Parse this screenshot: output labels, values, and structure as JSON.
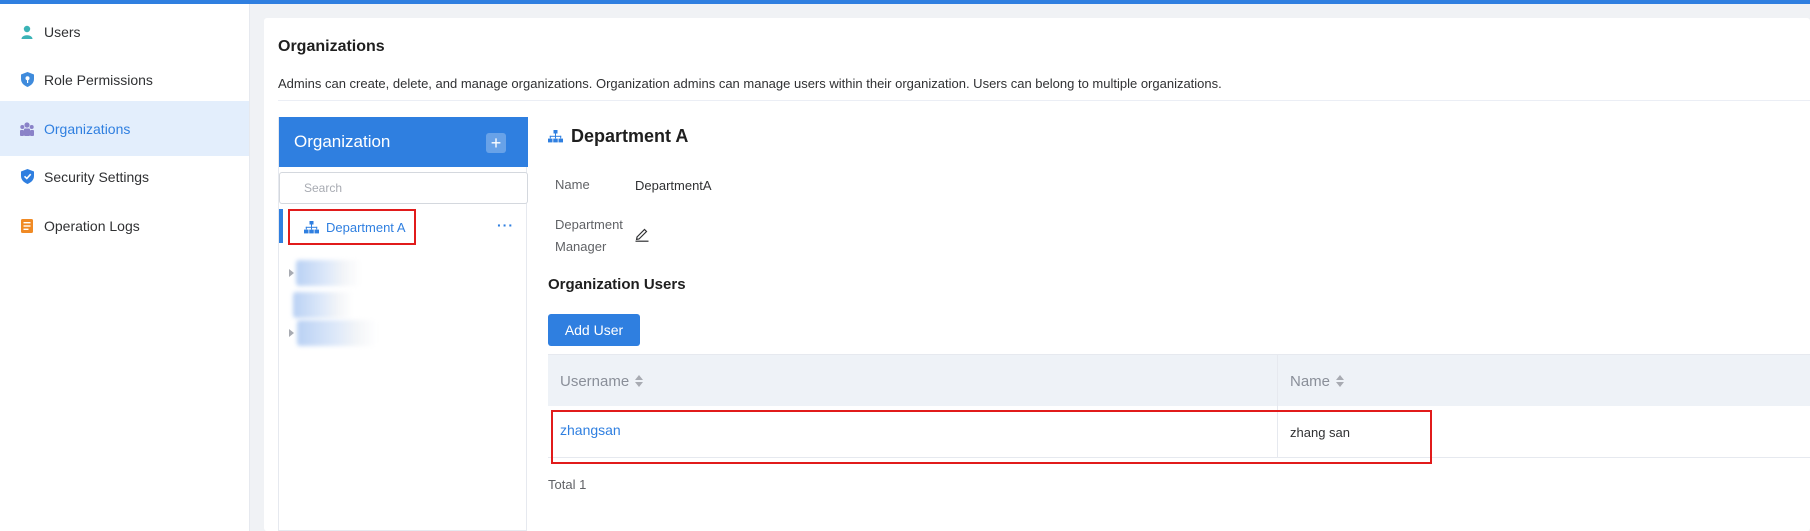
{
  "colors": {
    "accent": "#2f7fe0",
    "highlight": "#e11b1b",
    "active_bg": "#e3eefc"
  },
  "sidebar": {
    "items": [
      {
        "label": "Users",
        "icon": "user-icon",
        "color": "#3bb3b6"
      },
      {
        "label": "Role Permissions",
        "icon": "role-key-icon",
        "color": "#3f8bdc"
      },
      {
        "label": "Organizations",
        "icon": "organization-icon",
        "color": "#8a82c8",
        "active": true
      },
      {
        "label": "Security Settings",
        "icon": "shield-icon",
        "color": "#2f7fe0"
      },
      {
        "label": "Operation Logs",
        "icon": "log-icon",
        "color": "#f08a24"
      }
    ]
  },
  "page": {
    "title": "Organizations",
    "description": "Admins can create, delete, and manage organizations. Organization admins can manage users within their organization. Users can belong to multiple organizations."
  },
  "org_panel": {
    "header": "Organization",
    "add_symbol": "+",
    "search_placeholder": "Search",
    "selected_node": "Department A",
    "more_symbol": "···"
  },
  "detail": {
    "title": "Department A",
    "name_label": "Name",
    "name_value": "DepartmentA",
    "manager_label_line1": "Department",
    "manager_label_line2": "Manager",
    "users_section_title": "Organization Users",
    "add_user_label": "Add User",
    "table": {
      "columns": [
        "Username",
        "Name"
      ],
      "rows": [
        {
          "username": "zhangsan",
          "name": "zhang san"
        }
      ]
    },
    "total_text": "Total 1"
  }
}
